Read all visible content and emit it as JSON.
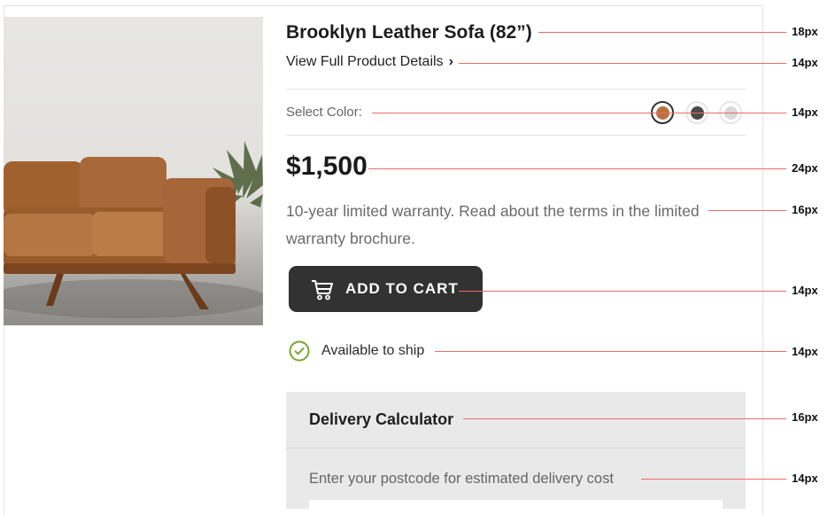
{
  "product": {
    "title": "Brooklyn Leather Sofa (82”)",
    "details_link": "View Full Product Details",
    "details_link_icon": "chevron-right-icon",
    "price": "$1,500",
    "warranty": "10-year limited warranty. Read about the terms in the limited warranty brochure."
  },
  "color_picker": {
    "label": "Select Color:",
    "swatches": [
      {
        "name": "tan",
        "color": "#b8733f",
        "selected": true
      },
      {
        "name": "dark",
        "color": "#4a4a4a",
        "selected": false
      },
      {
        "name": "light-grey",
        "color": "#d9d9d9",
        "selected": false
      }
    ]
  },
  "cart": {
    "label": "ADD TO CART",
    "icon": "cart-icon",
    "background": "#323232"
  },
  "availability": {
    "label": "Available to ship",
    "icon": "check-circle-icon",
    "color": "#7aa52a"
  },
  "delivery": {
    "title": "Delivery Calculator",
    "instructions": "Enter your postcode for estimated delivery cost",
    "postcode_value": ""
  },
  "annotations": {
    "title": "18px",
    "details_link": "14px",
    "color_label": "14px",
    "price": "24px",
    "warranty": "16px",
    "cart": "14px",
    "availability": "14px",
    "delivery_title": "16px",
    "delivery_instructions": "14px",
    "line_color": "#ef6a6a"
  }
}
